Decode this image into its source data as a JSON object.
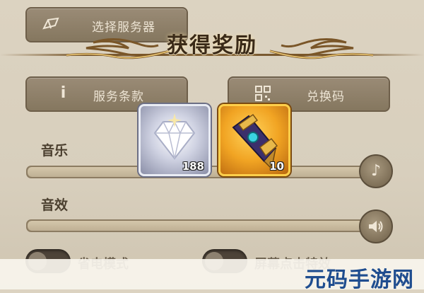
{
  "settings": {
    "server_button": {
      "label": "选择服务器",
      "icon": "map-pin-icon"
    },
    "terms_button": {
      "label": "服务条款",
      "icon": "info-icon"
    },
    "redeem_button": {
      "label": "兑换码",
      "icon": "qr-code-icon"
    },
    "music": {
      "label": "音乐",
      "level": 1.0,
      "icon": "music-note-icon"
    },
    "sound": {
      "label": "音效",
      "level": 1.0,
      "icon": "speaker-icon"
    },
    "power_saving": {
      "label": "省电模式",
      "on": false
    },
    "tap_effect": {
      "label": "屏幕点击特效",
      "on": false
    }
  },
  "reward_popup": {
    "title": "获得奖励",
    "items": [
      {
        "name": "diamond",
        "icon": "diamond-icon",
        "count": "188",
        "rarity_color": "#e9ecf4"
      },
      {
        "name": "bracer",
        "icon": "gauntlet-icon",
        "count": "10",
        "rarity_color": "#ffcf4a"
      }
    ]
  },
  "watermark": "元码手游网"
}
